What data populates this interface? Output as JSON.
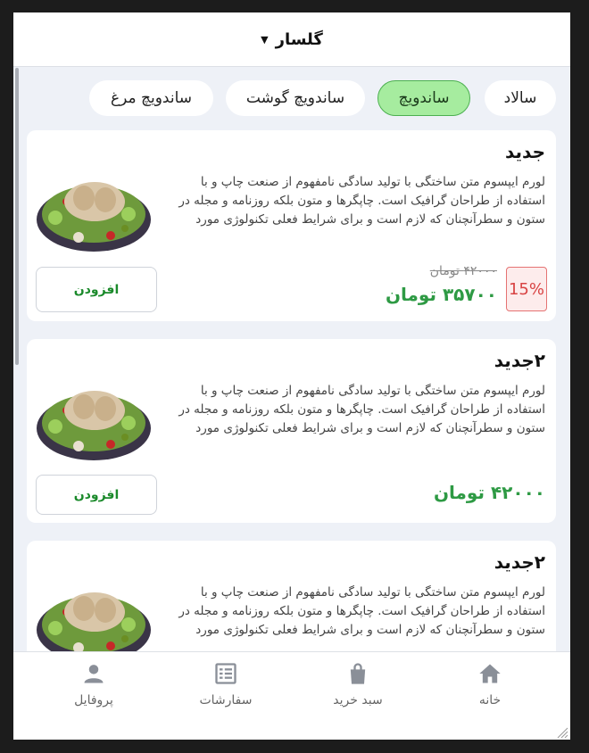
{
  "header": {
    "title": "گلسار",
    "caret_icon": "caret-down-icon"
  },
  "categories": [
    {
      "label": "سالاد",
      "active": false
    },
    {
      "label": "ساندویچ",
      "active": true
    },
    {
      "label": "ساندویچ گوشت",
      "active": false
    },
    {
      "label": "ساندویچ مرغ",
      "active": false
    }
  ],
  "products": [
    {
      "name": "جدید",
      "description": "لورم ایپسوم متن ساختگی با تولید سادگی نامفهوم از صنعت چاپ و با استفاده از طراحان گرافیک است. چاپگرها و متون بلکه روزنامه و مجله در ستون و سطرآنچنان که لازم است و برای شرایط فعلی تکنولوژی مورد نیاز...",
      "discount": "15%",
      "old_price": "۴۲۰۰۰ تومان",
      "price": "۳۵۷۰۰ تومان",
      "add_label": "افزودن"
    },
    {
      "name": "۲جدید",
      "description": "لورم ایپسوم متن ساختگی با تولید سادگی نامفهوم از صنعت چاپ و با استفاده از طراحان گرافیک است. چاپگرها و متون بلکه روزنامه و مجله در ستون و سطرآنچنان که لازم است و برای شرایط فعلی تکنولوژی مورد نیاز...",
      "price": "۴۲۰۰۰ تومان",
      "add_label": "افزودن"
    },
    {
      "name": "۲جدید",
      "description": "لورم ایپسوم متن ساختگی با تولید سادگی نامفهوم از صنعت چاپ و با استفاده از طراحان گرافیک است. چاپگرها و متون بلکه روزنامه و مجله در ستون و سطرآنچنان که لازم است و برای شرایط فعلی تکنولوژی مورد نیاز..."
    }
  ],
  "nav": [
    {
      "label": "خانه",
      "icon": "home-icon"
    },
    {
      "label": "سبد خرید",
      "icon": "shopping-bag-icon"
    },
    {
      "label": "سفارشات",
      "icon": "orders-list-icon"
    },
    {
      "label": "پروفایل",
      "icon": "person-icon"
    }
  ],
  "colors": {
    "accent_green": "#2e9a44",
    "active_tab": "#a6ec9f",
    "discount_red": "#d84343"
  }
}
